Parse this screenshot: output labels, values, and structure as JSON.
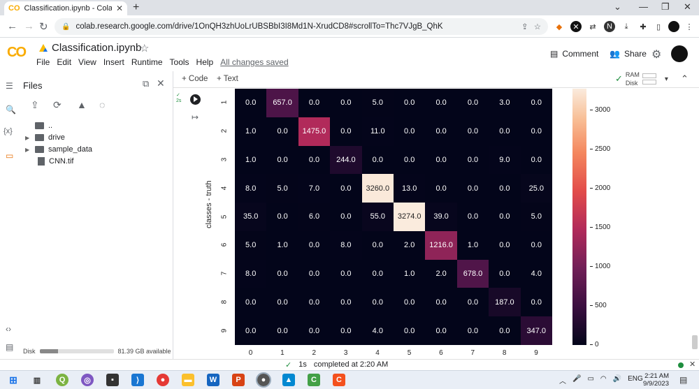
{
  "browser": {
    "tab_title": "Classification.ipynb - Colaborato",
    "tab_icon": "CO",
    "url": "colab.research.google.com/drive/1OnQH3zhUoLrUBSBbI3I8Md1N-XrudCD8#scrollTo=Thc7VJgB_QhK"
  },
  "colab": {
    "logo": "CO",
    "notebook_title": "Classification.ipynb",
    "menus": [
      "File",
      "Edit",
      "View",
      "Insert",
      "Runtime",
      "Tools",
      "Help"
    ],
    "saved_status": "All changes saved",
    "comment_label": "Comment",
    "share_label": "Share",
    "add_code_label": "+ Code",
    "add_text_label": "+ Text",
    "ram_label": "RAM",
    "disk_label": "Disk"
  },
  "files_panel": {
    "title": "Files",
    "items": [
      {
        "name": "..",
        "type": "parent"
      },
      {
        "name": "drive",
        "type": "folder"
      },
      {
        "name": "sample_data",
        "type": "folder"
      },
      {
        "name": "CNN.tif",
        "type": "file"
      }
    ],
    "disk_label": "Disk",
    "disk_available": "81.39 GB available",
    "disk_used_fraction": 0.25
  },
  "cell": {
    "exec_time": "2s"
  },
  "chart_data": {
    "type": "heatmap",
    "ylabel": "classes - truth",
    "xlabel": "",
    "row_labels": [
      "1",
      "2",
      "3",
      "4",
      "5",
      "6",
      "7",
      "8",
      "9"
    ],
    "col_labels": [
      "0",
      "1",
      "2",
      "3",
      "4",
      "5",
      "6",
      "7",
      "8",
      "9"
    ],
    "values": [
      [
        0.0,
        657.0,
        0.0,
        0.0,
        5.0,
        0.0,
        0.0,
        0.0,
        3.0,
        0.0
      ],
      [
        1.0,
        0.0,
        1475.0,
        0.0,
        11.0,
        0.0,
        0.0,
        0.0,
        0.0,
        0.0
      ],
      [
        1.0,
        0.0,
        0.0,
        244.0,
        0.0,
        0.0,
        0.0,
        0.0,
        9.0,
        0.0
      ],
      [
        8.0,
        5.0,
        7.0,
        0.0,
        3260.0,
        13.0,
        0.0,
        0.0,
        0.0,
        25.0
      ],
      [
        35.0,
        0.0,
        6.0,
        0.0,
        55.0,
        3274.0,
        39.0,
        0.0,
        0.0,
        5.0
      ],
      [
        5.0,
        1.0,
        0.0,
        8.0,
        0.0,
        2.0,
        1216.0,
        1.0,
        0.0,
        0.0
      ],
      [
        8.0,
        0.0,
        0.0,
        0.0,
        0.0,
        1.0,
        2.0,
        678.0,
        0.0,
        4.0
      ],
      [
        0.0,
        0.0,
        0.0,
        0.0,
        0.0,
        0.0,
        0.0,
        0.0,
        187.0,
        0.0
      ],
      [
        0.0,
        0.0,
        0.0,
        0.0,
        4.0,
        0.0,
        0.0,
        0.0,
        0.0,
        347.0
      ]
    ],
    "colorbar_ticks": [
      0,
      500,
      1000,
      1500,
      2000,
      2500,
      3000
    ],
    "colorbar_range": [
      0,
      3274
    ]
  },
  "status": {
    "check": "✓",
    "duration": "1s",
    "message": "completed at 2:20 AM"
  },
  "taskbar": {
    "language": "ENG",
    "time": "2:21 AM",
    "date": "9/9/2023"
  }
}
